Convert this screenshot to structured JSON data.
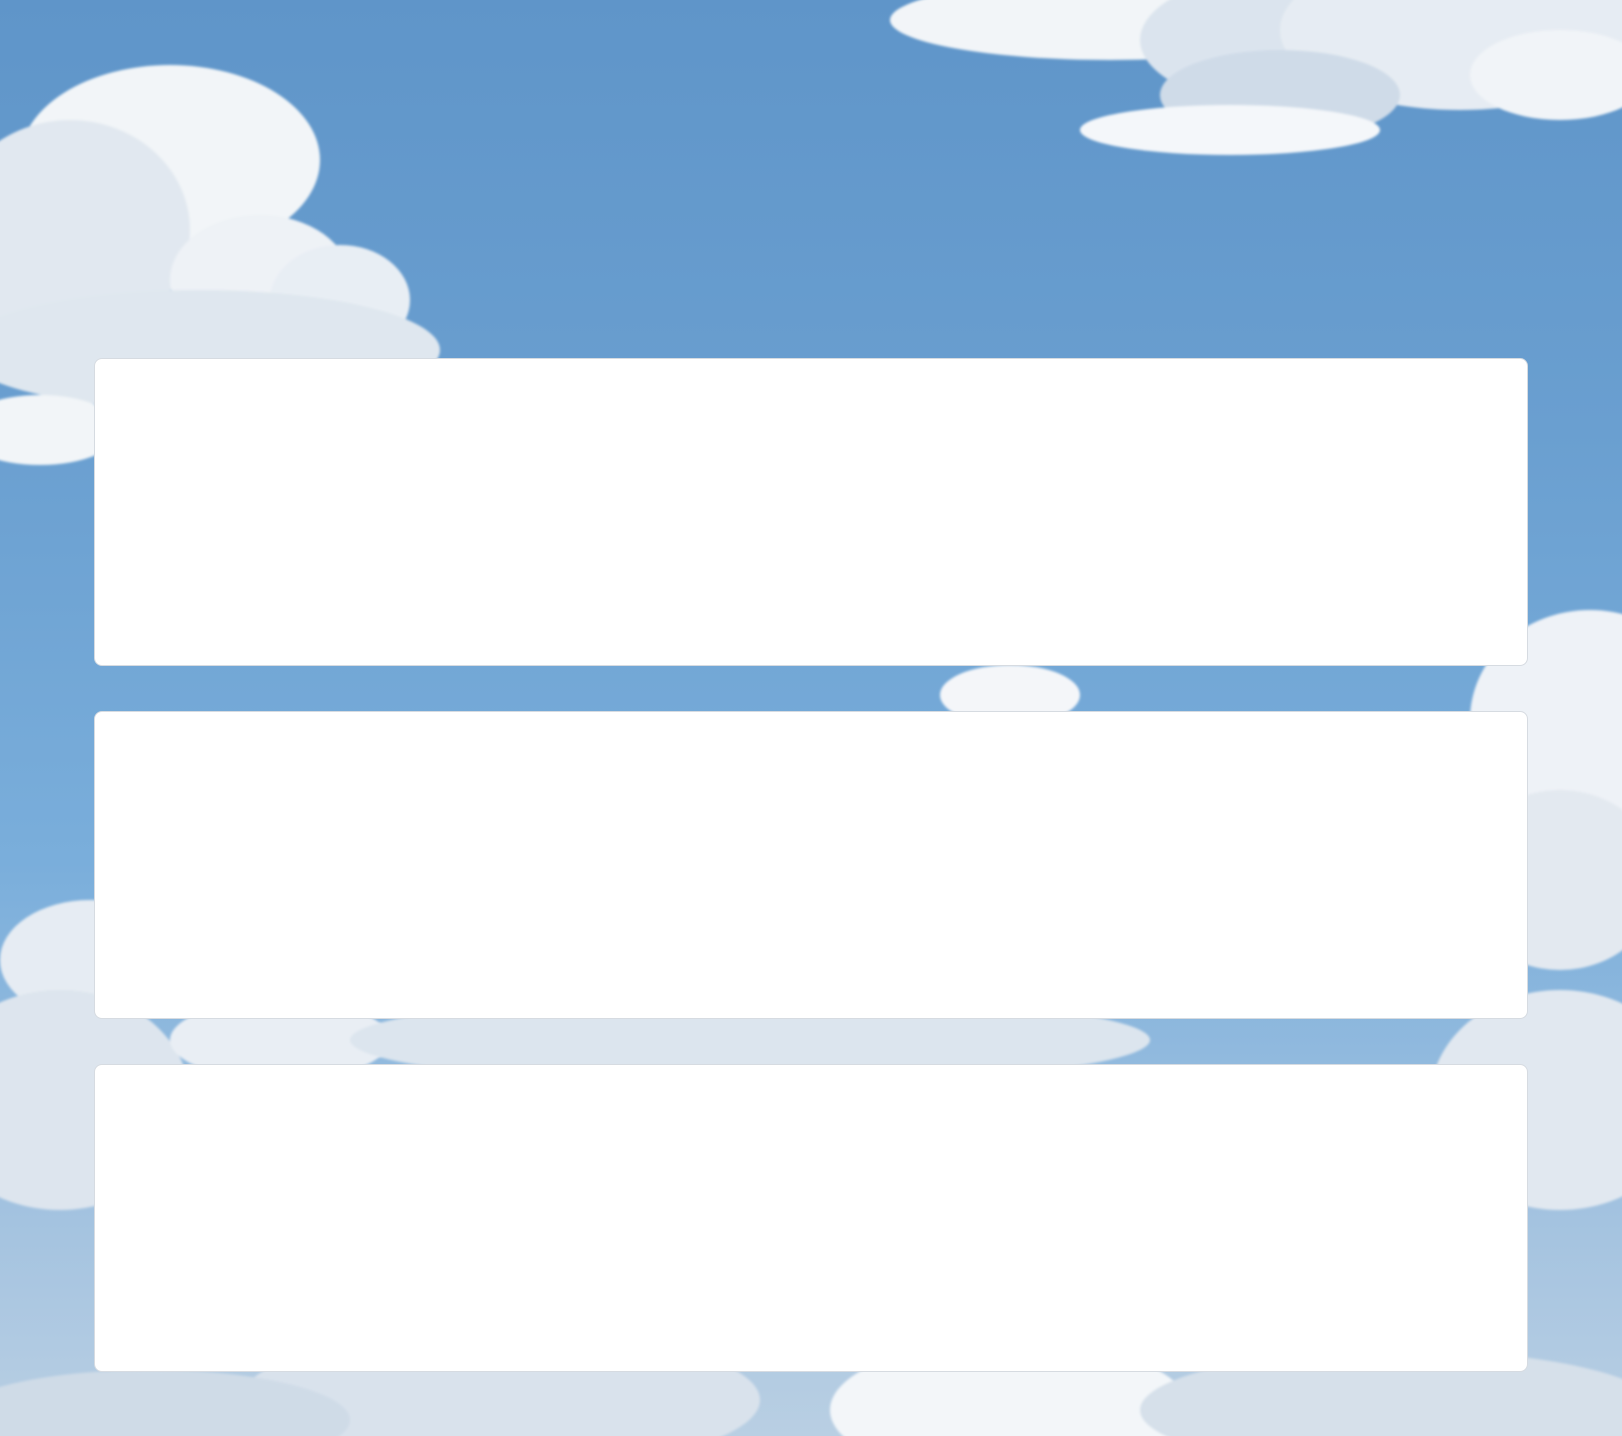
{
  "background": {
    "theme": "sky-with-clouds",
    "colors": {
      "sky_top": "#5f95c9",
      "sky_bottom": "#b9cfe3",
      "cloud_light": "#f6f8fa",
      "cloud_shade": "#d3dde8",
      "card": "#ffffff",
      "card_border": "#d6dbe1"
    }
  },
  "cards": [
    {
      "label": ""
    },
    {
      "label": ""
    },
    {
      "label": ""
    }
  ]
}
